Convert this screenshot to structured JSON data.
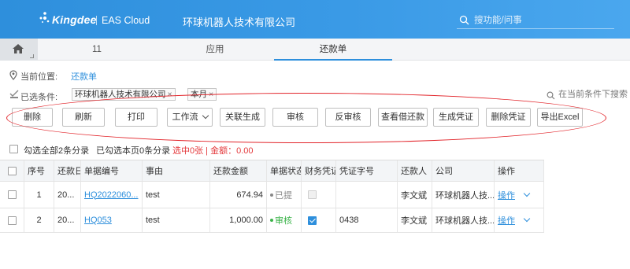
{
  "header": {
    "logo_text": "Kingdee",
    "product": "EAS Cloud",
    "company": "环球机器人技术有限公司",
    "search_placeholder": "搜功能/问事",
    "brand_color": "#2e8fdc"
  },
  "tabs": [
    {
      "label": "11"
    },
    {
      "label": "应用"
    },
    {
      "label": "还款单",
      "active": true
    }
  ],
  "location": {
    "label": "当前位置:",
    "value": "还款单"
  },
  "conditions": {
    "label": "已选条件:",
    "chips": [
      {
        "text": "环球机器人技术有限公司",
        "close": "×"
      },
      {
        "text": "本月",
        "close": "×"
      }
    ],
    "search_placeholder": "在当前条件下搜索"
  },
  "toolbar": {
    "buttons": [
      "删除",
      "刷新",
      "打印",
      "工作流",
      "关联生成",
      "审核",
      "反审核",
      "查看借还款",
      "生成凭证",
      "删除凭证",
      "导出Excel"
    ]
  },
  "selection_summary": {
    "select_all": "勾选全部2条分录",
    "page_selected": "已勾选本页0条分录",
    "selected_info": "选中0张 | 金额：0.00"
  },
  "table": {
    "columns": [
      "",
      "序号",
      "还款日",
      "单据编号",
      "事由",
      "还款金额",
      "单据状态",
      "财务凭证",
      "凭证字号",
      "还款人",
      "公司",
      "操作"
    ],
    "rows": [
      {
        "seq": "1",
        "date": "20...",
        "number": "HQ2022060...",
        "reason": "test",
        "amount": "674.94",
        "status": "已提",
        "status_color": "#888888",
        "fin_voucher": false,
        "fin_voucher_disabled": true,
        "voucher_no": "",
        "payer": "李文斌",
        "company": "环球机器人技...",
        "action": "操作"
      },
      {
        "seq": "2",
        "date": "20...",
        "number": "HQ053",
        "reason": "test",
        "amount": "1,000.00",
        "status": "审核",
        "status_color": "#3bb34a",
        "fin_voucher": true,
        "fin_voucher_disabled": false,
        "voucher_no": "0438",
        "payer": "李文斌",
        "company": "环球机器人技...",
        "action": "操作"
      }
    ]
  },
  "icons": {
    "logo": "kingdee-logo-icon",
    "search": "search-icon",
    "home": "home-icon",
    "location": "location-pin-icon",
    "conditions": "filter-check-icon",
    "dropdown": "chevron-down-icon"
  }
}
